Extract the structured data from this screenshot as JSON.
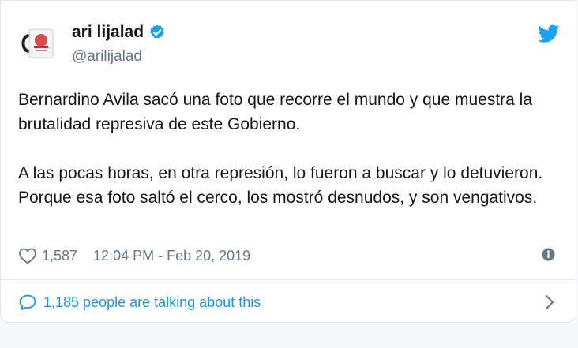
{
  "user": {
    "name": "ari lijalad",
    "handle": "@arilijalad",
    "verified": true
  },
  "tweet": {
    "paragraphs": [
      "Bernardino Avila sacó una foto que recorre el mundo y que muestra la brutalidad represiva de este Gobierno.",
      "A las pocas horas, en otra represión, lo fueron a buscar y lo detuvieron. Porque esa foto saltó el cerco, los mostró desnudos, y son vengativos."
    ]
  },
  "meta": {
    "likes": "1,587",
    "timestamp": "12:04 PM - Feb 20, 2019"
  },
  "footer": {
    "talking": "1,185 people are talking about this"
  },
  "icons": {
    "verified": "verified-badge-icon",
    "brand": "twitter-bird-icon",
    "like": "heart-icon",
    "info": "info-icon",
    "reply": "speech-bubble-icon",
    "chevron": "chevron-right-icon"
  },
  "colors": {
    "twitter_blue": "#1da1f2",
    "link_blue": "#1b95e0",
    "secondary_text": "#657786"
  }
}
